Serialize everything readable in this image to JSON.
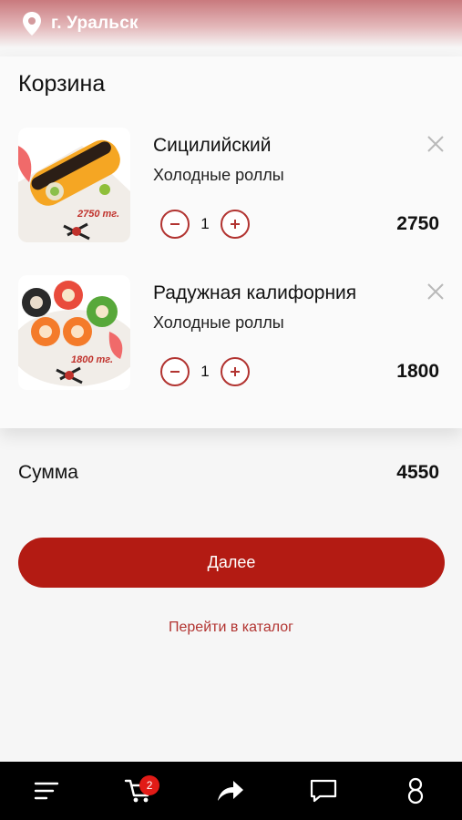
{
  "header": {
    "city": "г. Уральск"
  },
  "cart": {
    "title": "Корзина",
    "items": [
      {
        "name": "Сицилийский",
        "category": "Холодные роллы",
        "quantity": "1",
        "price": "2750",
        "image_price_tag": "2750 тг."
      },
      {
        "name": "Радужная калифорния",
        "category": "Холодные роллы",
        "quantity": "1",
        "price": "1800",
        "image_price_tag": "1800 тг."
      }
    ]
  },
  "summary": {
    "label": "Сумма",
    "value": "4550"
  },
  "actions": {
    "next_label": "Далее",
    "catalog_label": "Перейти в каталог"
  },
  "bottom_nav": {
    "cart_badge": "2"
  },
  "colors": {
    "accent": "#b31b13",
    "outline": "#b23431",
    "badge": "#e11b17"
  }
}
